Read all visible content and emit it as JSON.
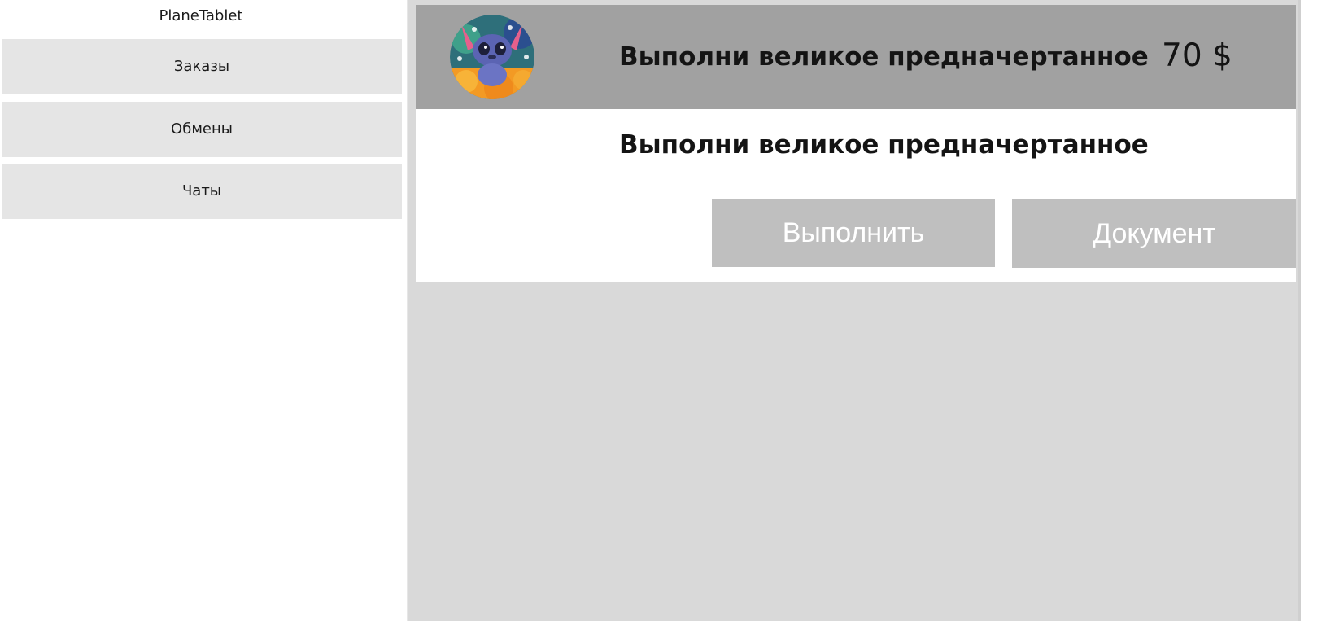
{
  "app": {
    "title": "PlaneTablet"
  },
  "sidebar": {
    "items": [
      {
        "label": "Заказы"
      },
      {
        "label": "Обмены"
      },
      {
        "label": "Чаты"
      }
    ]
  },
  "order": {
    "title": "Выполни великое предначертанное",
    "price": "70 $",
    "description": "Выполни великое предначертанное",
    "avatar_icon": "cartoon-character-avatar",
    "actions": {
      "execute_label": "Выполнить",
      "document_label": "Документ"
    }
  },
  "colors": {
    "header_bg": "#a1a1a1",
    "main_bg": "#d9d9d9",
    "nav_item_bg": "#e5e5e5",
    "button_bg": "#bfbfbf"
  }
}
